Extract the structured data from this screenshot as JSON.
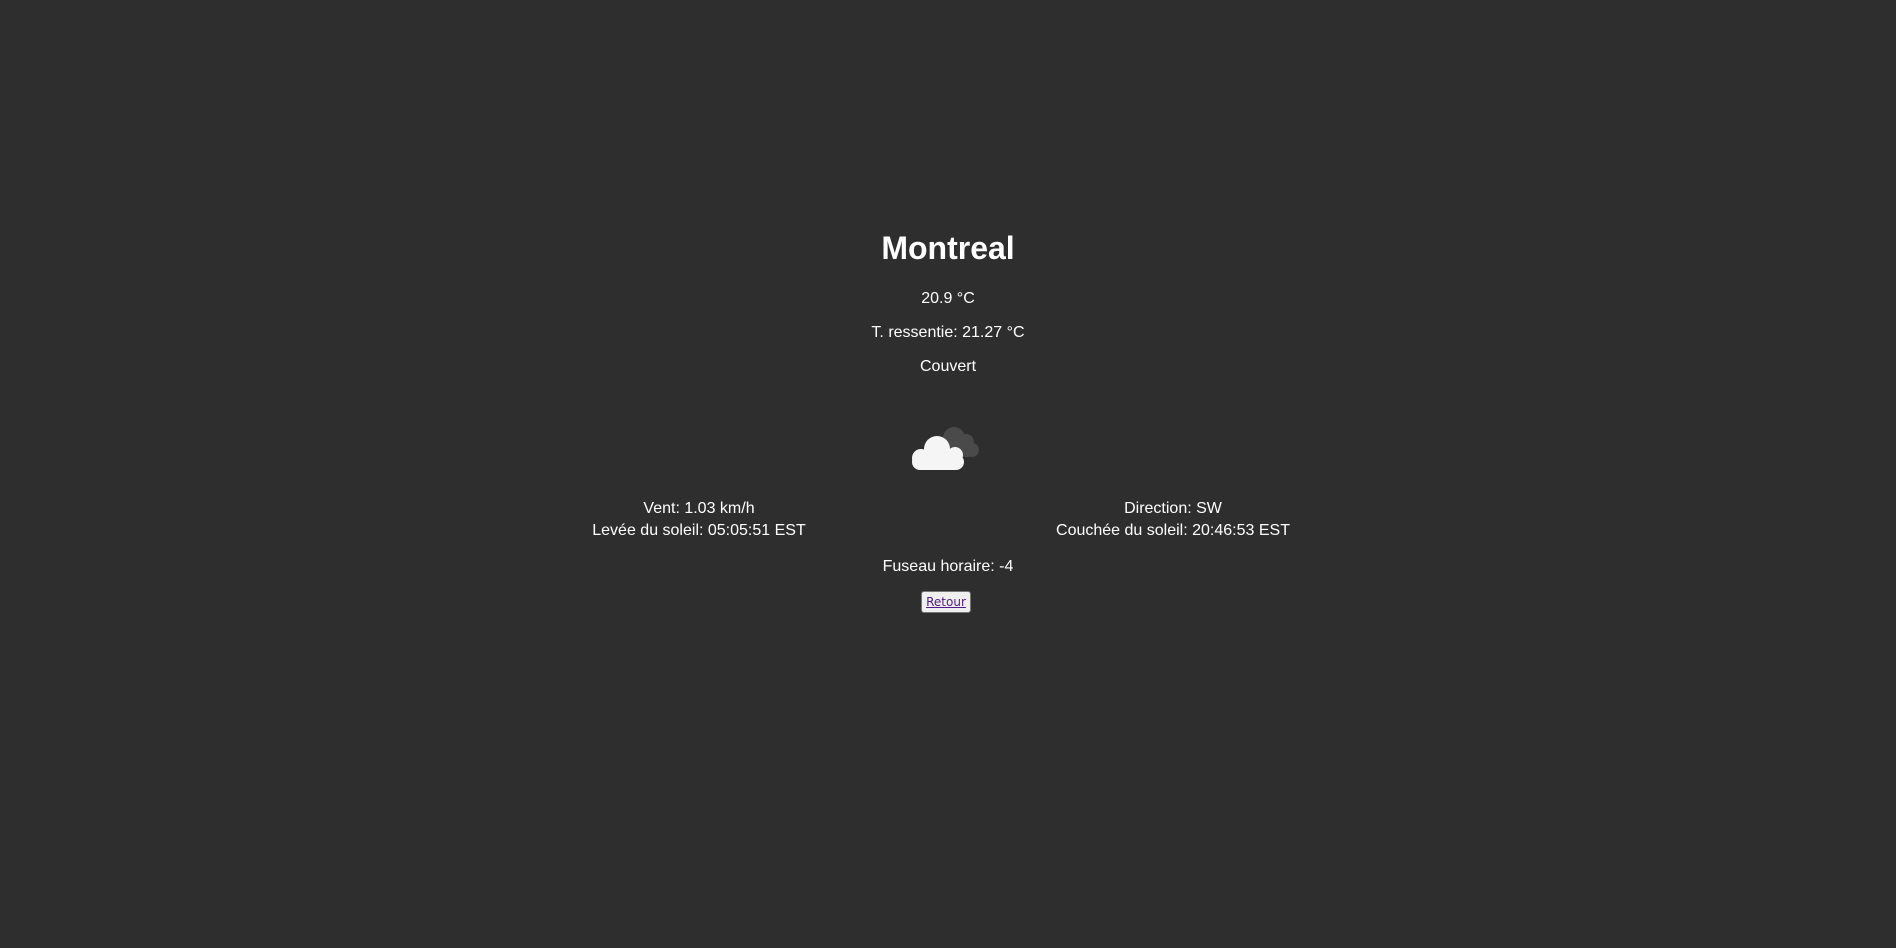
{
  "city": "Montreal",
  "temperature": "20.9 °C",
  "feels_like": "T. ressentie: 21.27 °C",
  "description": "Couvert",
  "weather_icon": "overcast-clouds-icon",
  "wind": "Vent: 1.03 km/h",
  "direction": "Direction: SW",
  "sunrise": "Levée du soleil: 05:05:51 EST",
  "sunset": "Couchée du soleil: 20:46:53 EST",
  "timezone": "Fuseau horaire: -4",
  "back_label": "Retour",
  "colors": {
    "background": "#2e2e2e",
    "text": "#ffffff",
    "cloud_front": "#f5f5f5",
    "cloud_back": "#4a4a4a",
    "link": "#551a8b"
  }
}
